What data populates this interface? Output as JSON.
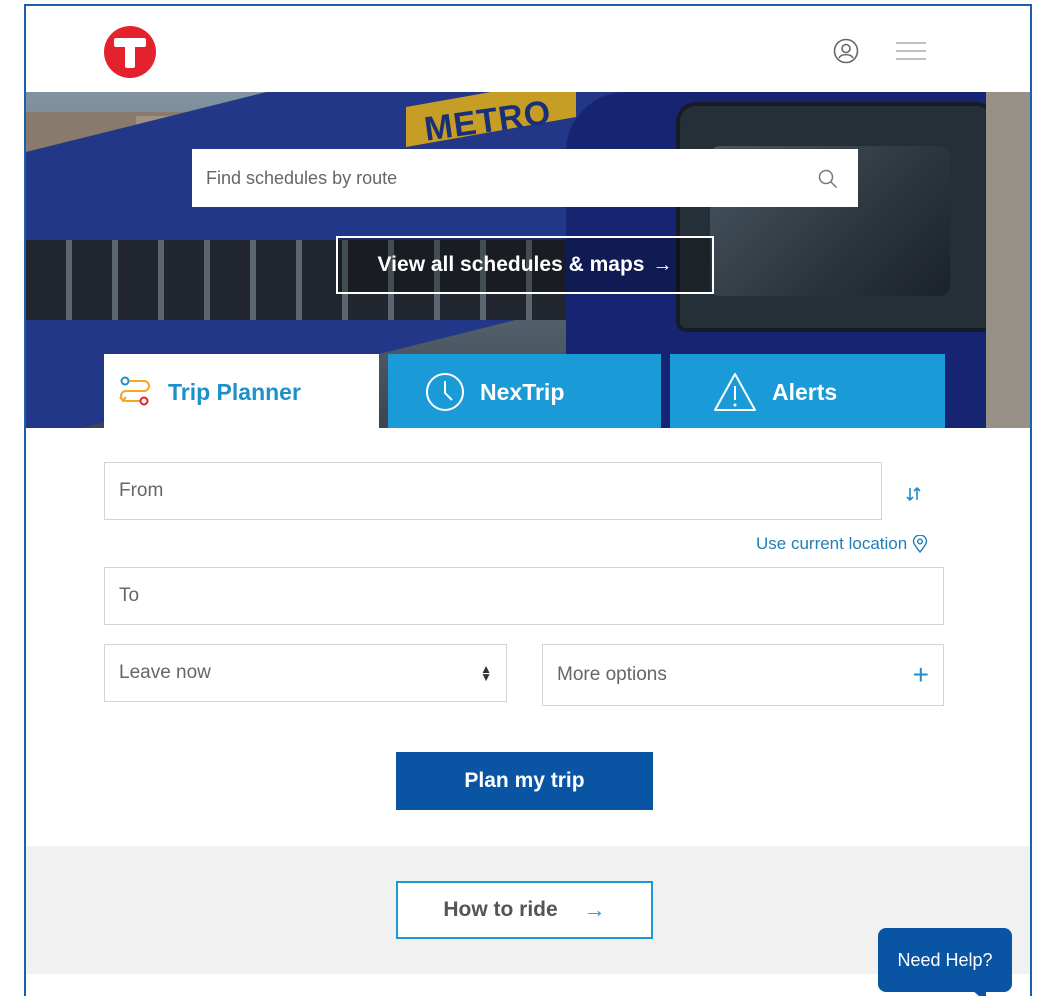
{
  "header": {
    "logo_icon": "metro-transit-t-logo",
    "account_icon": "user-circle-icon",
    "menu_icon": "hamburger-menu-icon"
  },
  "hero": {
    "search": {
      "placeholder": "Find schedules by route",
      "icon": "search-icon"
    },
    "view_all_label": "View all schedules & maps",
    "view_all_arrow": "→",
    "train_sign": "METRO"
  },
  "tabs": [
    {
      "label": "Trip Planner",
      "icon": "route-icon",
      "active": true
    },
    {
      "label": "NexTrip",
      "icon": "clock-icon",
      "active": false
    },
    {
      "label": "Alerts",
      "icon": "warning-icon",
      "active": false
    }
  ],
  "trip_form": {
    "from_placeholder": "From",
    "to_placeholder": "To",
    "use_current_location": "Use current location",
    "leave_select": "Leave now",
    "more_options": "More options",
    "more_options_symbol": "+",
    "plan_button": "Plan my trip"
  },
  "how_to_ride": {
    "label": "How to ride",
    "arrow": "→"
  },
  "help": {
    "label": "Need Help?"
  },
  "colors": {
    "brand_red": "#e4222e",
    "tab_blue": "#1a9ad6",
    "primary_blue": "#0a55a3",
    "link_blue": "#1e7fb8"
  }
}
